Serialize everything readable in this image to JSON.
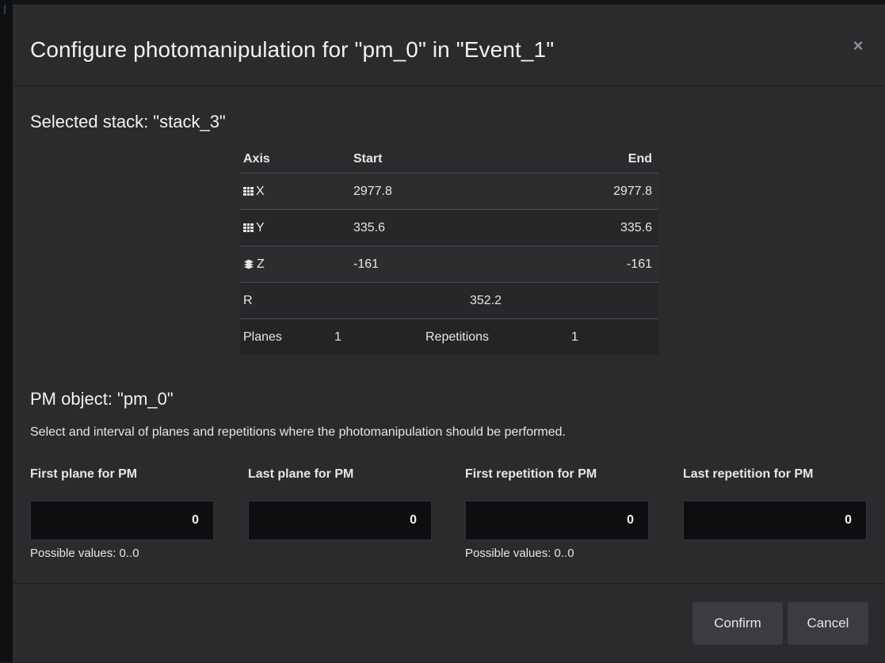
{
  "modal": {
    "title": "Configure photomanipulation for \"pm_0\" in \"Event_1\"",
    "close_label": "×"
  },
  "stack": {
    "heading": "Selected stack: \"stack_3\"",
    "table": {
      "headers": {
        "axis": "Axis",
        "start": "Start",
        "end": "End"
      },
      "rows": [
        {
          "icon": "grid-icon",
          "axis": "X",
          "start": "2977.8",
          "end": "2977.8"
        },
        {
          "icon": "grid-icon",
          "axis": "Y",
          "start": "335.6",
          "end": "335.6"
        },
        {
          "icon": "layers-icon",
          "axis": "Z",
          "start": "-161",
          "end": "-161"
        }
      ],
      "r_row": {
        "label": "R",
        "value": "352.2"
      },
      "summary_row": {
        "planes_label": "Planes",
        "planes_value": "1",
        "repetitions_label": "Repetitions",
        "repetitions_value": "1"
      }
    }
  },
  "pm": {
    "heading": "PM object: \"pm_0\"",
    "instructions": "Select and interval of planes and repetitions where the photomanipulation should be performed.",
    "fields": [
      {
        "label": "First plane for PM",
        "value": "0",
        "help": "Possible values: 0..0"
      },
      {
        "label": "Last plane for PM",
        "value": "0",
        "help": ""
      },
      {
        "label": "First repetition for PM",
        "value": "0",
        "help": "Possible values: 0..0"
      },
      {
        "label": "Last repetition for PM",
        "value": "0",
        "help": ""
      }
    ]
  },
  "footer": {
    "confirm_label": "Confirm",
    "cancel_label": "Cancel"
  }
}
